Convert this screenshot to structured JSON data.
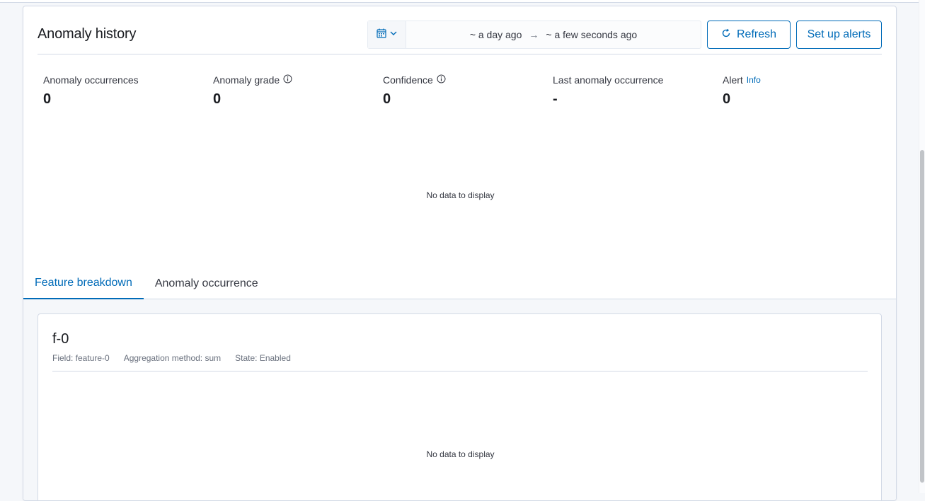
{
  "panel": {
    "title": "Anomaly history",
    "date_range": {
      "start": "~ a day ago",
      "arrow": "→",
      "end": "~ a few seconds ago"
    },
    "refresh_label": "Refresh",
    "alerts_label": "Set up alerts"
  },
  "stats": [
    {
      "label": "Anomaly occurrences",
      "value": "0"
    },
    {
      "label": "Anomaly grade",
      "value": "0"
    },
    {
      "label": "Confidence",
      "value": "0"
    },
    {
      "label": "Last anomaly occurrence",
      "value": "-"
    },
    {
      "label": "Alert",
      "link": "Info",
      "value": "0"
    }
  ],
  "chart_empty_text": "No data to display",
  "tabs": [
    {
      "label": "Feature breakdown",
      "active": true
    },
    {
      "label": "Anomaly occurrence",
      "active": false
    }
  ],
  "feature": {
    "title": "f-0",
    "field": "Field: feature-0",
    "aggregation": "Aggregation method: sum",
    "state": "State: Enabled",
    "empty_text": "No data to display"
  },
  "colors": {
    "accent": "#006bb8",
    "border": "#d3dae6",
    "text": "#1a1c21",
    "muted": "#69707d",
    "background": "#f5f7fa"
  }
}
